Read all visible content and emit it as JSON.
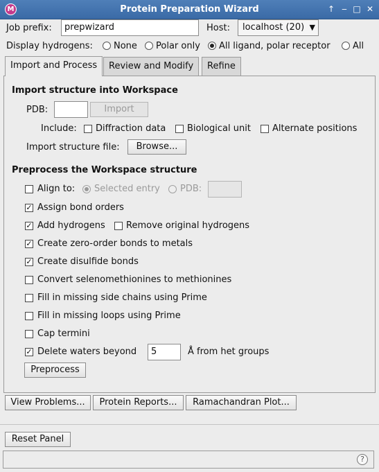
{
  "window": {
    "title": "Protein Preparation Wizard",
    "icon_letter": "M"
  },
  "header": {
    "job_prefix_label": "Job prefix:",
    "job_prefix_value": "prepwizard",
    "host_label": "Host:",
    "host_value": "localhost (20)",
    "display_h_label": "Display hydrogens:",
    "display_h_options": [
      "None",
      "Polar only",
      "All ligand, polar receptor",
      "All"
    ],
    "display_h_selected": "All ligand, polar receptor"
  },
  "tabs": [
    "Import and Process",
    "Review and Modify",
    "Refine"
  ],
  "import_section": {
    "heading": "Import structure into Workspace",
    "pdb_label": "PDB:",
    "pdb_value": "",
    "import_button": "Import",
    "include_label": "Include:",
    "include_options": [
      {
        "label": "Diffraction data",
        "checked": false
      },
      {
        "label": "Biological unit",
        "checked": false
      },
      {
        "label": "Alternate positions",
        "checked": false
      }
    ],
    "file_label": "Import structure file:",
    "browse_button": "Browse..."
  },
  "preprocess_section": {
    "heading": "Preprocess the Workspace structure",
    "align_label": "Align to:",
    "align_checked": false,
    "align_selected_entry": "Selected entry",
    "align_pdb": "PDB:",
    "align_pdb_value": "",
    "assign_bond_orders": {
      "label": "Assign bond orders",
      "checked": true
    },
    "add_hydrogens": {
      "label": "Add hydrogens",
      "checked": true
    },
    "remove_hydrogens": {
      "label": "Remove original hydrogens",
      "checked": false
    },
    "zero_order": {
      "label": "Create zero-order bonds to metals",
      "checked": true
    },
    "disulfide": {
      "label": "Create disulfide bonds",
      "checked": true
    },
    "selenomet": {
      "label": "Convert selenomethionines to methionines",
      "checked": false
    },
    "side_chains": {
      "label": "Fill in missing side chains using Prime",
      "checked": false
    },
    "loops": {
      "label": "Fill in missing loops using Prime",
      "checked": false
    },
    "cap_termini": {
      "label": "Cap termini",
      "checked": false
    },
    "delete_waters": {
      "label": "Delete waters beyond",
      "checked": true,
      "value": "5",
      "suffix": "Å from het groups"
    },
    "preprocess_button": "Preprocess"
  },
  "bottom_buttons": {
    "view_problems": "View Problems...",
    "protein_reports": "Protein Reports...",
    "ramachandran": "Ramachandran Plot...",
    "reset_panel": "Reset Panel"
  },
  "status": {
    "help": "?"
  }
}
